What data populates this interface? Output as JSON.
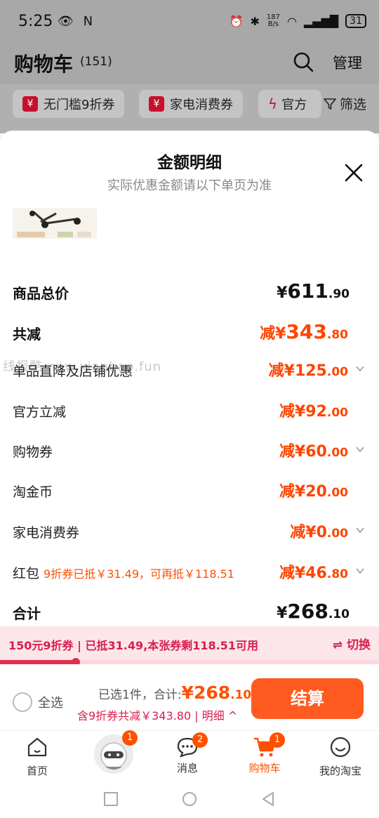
{
  "status_bar": {
    "time": "5:25",
    "net_speed_value": "187",
    "net_speed_unit": "B/s",
    "battery": "31"
  },
  "cart_header": {
    "title": "购物车",
    "count": "(151)",
    "manage_label": "管理"
  },
  "filter_chips": [
    {
      "label": "无门槛9折券"
    },
    {
      "label": "家电消费券"
    },
    {
      "label": "官方"
    }
  ],
  "filter_label": "筛选",
  "sheet": {
    "title": "金额明细",
    "subtitle": "实际优惠金额请以下单页为准",
    "watermark": "线报酷 new.xianbao.fun",
    "total_price": {
      "label": "商品总价",
      "currency": "¥",
      "int": "611",
      "cents": ".90"
    },
    "total_reduction": {
      "label": "共减",
      "prefix": "减¥",
      "int": "343",
      "cents": ".80"
    },
    "details": [
      {
        "label": "单品直降及店铺优惠",
        "prefix": "减¥",
        "int": "125",
        "cents": ".00",
        "chevron": true
      },
      {
        "label": "官方立减",
        "prefix": "减¥",
        "int": "92",
        "cents": ".00",
        "chevron": false
      },
      {
        "label": "购物券",
        "prefix": "减¥",
        "int": "60",
        "cents": ".00",
        "chevron": true
      },
      {
        "label": "淘金币",
        "prefix": "减¥",
        "int": "20",
        "cents": ".00",
        "chevron": false
      },
      {
        "label": "家电消费券",
        "prefix": "减¥",
        "int": "0",
        "cents": ".00",
        "chevron": true
      },
      {
        "label": "红包",
        "note": "9折券已抵￥31.49，可再抵￥118.51",
        "prefix": "减¥",
        "int": "46",
        "cents": ".80",
        "chevron": true
      }
    ],
    "grand_total": {
      "label": "合计",
      "currency": "¥",
      "int": "268",
      "cents": ".10"
    }
  },
  "coupon_banner": {
    "text": "150元9折券 | 已抵31.49,本张券剩118.51可用",
    "switch_label": "⇌ 切换",
    "used_fraction": 0.2
  },
  "checkout": {
    "select_all_label": "全选",
    "selected_prefix": "已选1件，合计:",
    "total_currency": "¥",
    "total_int": "268",
    "total_cents": ".10",
    "discount_text": "含9折券共减￥343.80 | 明细 ^",
    "button_label": "结算"
  },
  "tabbar": {
    "items": [
      {
        "label": "首页",
        "badge": ""
      },
      {
        "label": "消息",
        "badge": "2"
      },
      {
        "label": "购物车",
        "badge": "1"
      },
      {
        "label": "我的淘宝",
        "badge": ""
      }
    ],
    "avatar_badge": "1"
  },
  "colors": {
    "accent": "#ff5000",
    "coupon_red": "#d81e50",
    "checkout_button": "#ff5a1f"
  }
}
